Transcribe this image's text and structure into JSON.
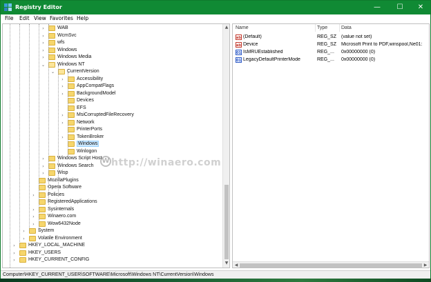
{
  "window": {
    "title": "Registry Editor",
    "accent": "#108a34",
    "controls": {
      "minimize": "—",
      "maximize": "☐",
      "close": "✕"
    }
  },
  "menu": [
    "File",
    "Edit",
    "View",
    "Favorites",
    "Help"
  ],
  "tree": {
    "rows": [
      {
        "label": "WAB",
        "toggle": ">"
      },
      {
        "label": "WcmSvc",
        "toggle": ">"
      },
      {
        "label": "wfs",
        "toggle": ">"
      },
      {
        "label": "Windows",
        "toggle": ">"
      },
      {
        "label": "Windows Media",
        "toggle": ">"
      },
      {
        "label": "Windows NT",
        "toggle": "v"
      },
      {
        "label": "CurrentVersion",
        "toggle": "v"
      },
      {
        "label": "Accessibility",
        "toggle": ">"
      },
      {
        "label": "AppCompatFlags",
        "toggle": ">"
      },
      {
        "label": "BackgroundModel",
        "toggle": ">"
      },
      {
        "label": "Devices",
        "toggle": ""
      },
      {
        "label": "EFS",
        "toggle": ""
      },
      {
        "label": "MsiCorruptedFileRecovery",
        "toggle": ">"
      },
      {
        "label": "Network",
        "toggle": ">"
      },
      {
        "label": "PrinterPorts",
        "toggle": ""
      },
      {
        "label": "TokenBroker",
        "toggle": ">"
      },
      {
        "label": "Windows",
        "toggle": ""
      },
      {
        "label": "Winlogon",
        "toggle": ""
      },
      {
        "label": "Windows Script Host",
        "toggle": ">"
      },
      {
        "label": "Windows Search",
        "toggle": ">"
      },
      {
        "label": "Wisp",
        "toggle": ">"
      },
      {
        "label": "MozillaPlugins",
        "toggle": ""
      },
      {
        "label": "Opera Software",
        "toggle": ""
      },
      {
        "label": "Policies",
        "toggle": ">"
      },
      {
        "label": "RegisteredApplications",
        "toggle": ""
      },
      {
        "label": "Sysinternals",
        "toggle": ">"
      },
      {
        "label": "Winaero.com",
        "toggle": ">"
      },
      {
        "label": "Wow6432Node",
        "toggle": ">"
      },
      {
        "label": "System",
        "toggle": ">"
      },
      {
        "label": "Volatile Environment",
        "toggle": ">"
      },
      {
        "label": "HKEY_LOCAL_MACHINE",
        "toggle": ">"
      },
      {
        "label": "HKEY_USERS",
        "toggle": ">"
      },
      {
        "label": "HKEY_CURRENT_CONFIG",
        "toggle": ">"
      }
    ],
    "selected_label": "Windows"
  },
  "values": {
    "headers": {
      "name": "Name",
      "type": "Type",
      "data": "Data"
    },
    "rows": [
      {
        "icon": "ab",
        "name": "(Default)",
        "type": "REG_SZ",
        "data": "(value not set)"
      },
      {
        "icon": "ab",
        "name": "Device",
        "type": "REG_SZ",
        "data": "Microsoft Print to PDF,winspool,Ne01:"
      },
      {
        "icon": "01",
        "name": "IsMRUEstablished",
        "type": "REG_...",
        "data": "0x00000000 (0)"
      },
      {
        "icon": "01",
        "name": "LegacyDefaultPrinterMode",
        "type": "REG_...",
        "data": "0x00000000 (0)"
      }
    ]
  },
  "statusbar": {
    "path": "Computer\\HKEY_CURRENT_USER\\SOFTWARE\\Microsoft\\Windows NT\\CurrentVersion\\Windows"
  },
  "watermark": {
    "text": "http://winaero.com",
    "icon": "W"
  }
}
